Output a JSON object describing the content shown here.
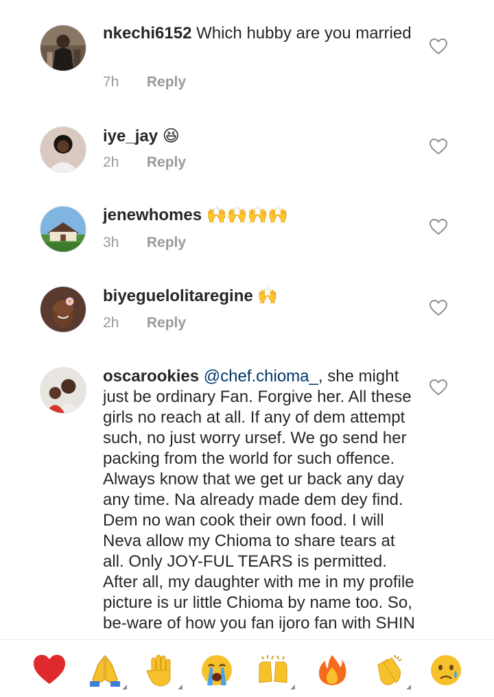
{
  "comments": [
    {
      "username": "nkechi6152",
      "text": "Which hubby are you married",
      "time": "7h",
      "reply": "Reply",
      "avatar_icon": "avatar-woman-dark"
    },
    {
      "username": "iye_jay",
      "text": "😆",
      "time": "2h",
      "reply": "Reply",
      "avatar_icon": "avatar-woman-smiling"
    },
    {
      "username": "jenewhomes",
      "text": "🙌🙌🙌🙌",
      "time": "3h",
      "reply": "Reply",
      "avatar_icon": "avatar-house"
    },
    {
      "username": "biyeguelolitaregine",
      "text": "🙌",
      "time": "2h",
      "reply": "Reply",
      "avatar_icon": "avatar-woman-flower"
    },
    {
      "username": "oscarookies",
      "mention": "@chef.chioma_",
      "text": ", she might just be ordinary Fan. Forgive her.  All these girls no reach at all.  If any of dem attempt such,  no just worry ursef. We go send her packing from the world for such offence. Always  know that we get ur back any day any time. Na already made dem dey find. Dem no wan cook their own food. I will Neva allow my Chioma to share tears at all. Only JOY-FUL TEARS is permitted. After all,  my daughter with me in my profile picture is ur little Chioma by name too. So,  be-ware of how you fan ijoro fan with SHIN",
      "avatar_icon": "avatar-father-daughter"
    }
  ],
  "emoji_bar": [
    {
      "name": "heart-emoji",
      "glyph": "❤️"
    },
    {
      "name": "folded-hands-emoji",
      "glyph": "🙏"
    },
    {
      "name": "raised-hand-emoji",
      "glyph": "✋"
    },
    {
      "name": "crying-face-emoji",
      "glyph": "😭"
    },
    {
      "name": "raising-hands-emoji",
      "glyph": "🙌"
    },
    {
      "name": "fire-emoji",
      "glyph": "🔥"
    },
    {
      "name": "clapping-hands-emoji",
      "glyph": "👏"
    },
    {
      "name": "sad-tear-face-emoji",
      "glyph": "😢"
    }
  ],
  "colors": {
    "text": "#262626",
    "meta": "#999999",
    "mention": "#003569",
    "heart": "#e0292c",
    "emoji_yellow": "#f7c12c"
  }
}
